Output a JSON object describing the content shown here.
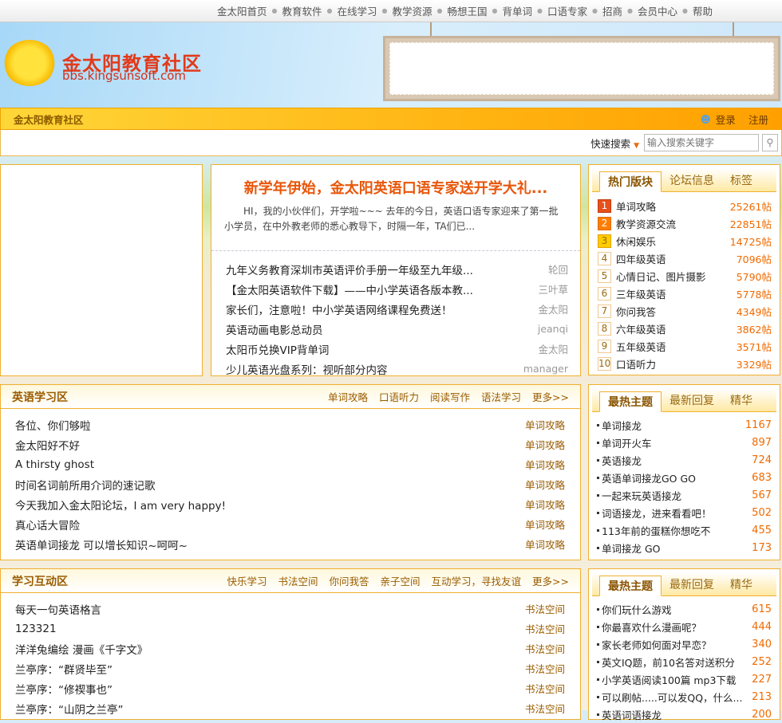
{
  "topnav": [
    "金太阳首页",
    "教育软件",
    "在线学习",
    "教学资源",
    "畅想王国",
    "背单词",
    "口语专家",
    "招商",
    "会员中心",
    "帮助"
  ],
  "logo": {
    "title": "金太阳教育社区",
    "url": "bbs.kingsunsoft.com"
  },
  "bar": {
    "title": "金太阳教育社区",
    "login": "登录",
    "register": "注册"
  },
  "search": {
    "label": "快速搜索",
    "placeholder": "输入搜索关键字"
  },
  "featured": {
    "title": "新学年伊始，金太阳英语口语专家送开学大礼...",
    "summary": "HI，我的小伙伴们，开学啦~~~ 去年的今日，英语口语专家迎来了第一批小学员，在中外教老师的悉心教导下，时隔一年，TA们已...",
    "items": [
      {
        "t": "九年义务教育深圳市英语评价手册一年级至九年级...",
        "a": "轮回"
      },
      {
        "t": "【金太阳英语软件下载】——中小学英语各版本教...",
        "a": "三叶草"
      },
      {
        "t": "家长们，注意啦！中小学英语网络课程免费送！",
        "a": "金太阳"
      },
      {
        "t": "英语动画电影总动员",
        "a": "jeanqi"
      },
      {
        "t": "太阳币兑换VIP背单词",
        "a": "金太阳"
      },
      {
        "t": "少儿英语光盘系列：视听部分内容",
        "a": "manager"
      }
    ]
  },
  "hotboards": {
    "tabs": [
      "热门版块",
      "论坛信息",
      "标签"
    ],
    "items": [
      {
        "n": "1",
        "t": "单词攻略",
        "c": "25261帖"
      },
      {
        "n": "2",
        "t": "教学资源交流",
        "c": "22851帖"
      },
      {
        "n": "3",
        "t": "休闲娱乐",
        "c": "14725帖"
      },
      {
        "n": "4",
        "t": "四年级英语",
        "c": "7096帖"
      },
      {
        "n": "5",
        "t": "心情日记、图片摄影",
        "c": "5790帖"
      },
      {
        "n": "6",
        "t": "三年级英语",
        "c": "5778帖"
      },
      {
        "n": "7",
        "t": "你问我答",
        "c": "4349帖"
      },
      {
        "n": "8",
        "t": "六年级英语",
        "c": "3862帖"
      },
      {
        "n": "9",
        "t": "五年级英语",
        "c": "3571帖"
      },
      {
        "n": "10",
        "t": "口语听力",
        "c": "3329帖"
      }
    ],
    "rank_colors": [
      "#e8501a",
      "#ff7e00",
      "#ffcc00"
    ]
  },
  "english": {
    "title": "英语学习区",
    "links": [
      "单词攻略",
      "口语听力",
      "阅读写作",
      "语法学习",
      "更多>>"
    ],
    "items": [
      {
        "t": "各位、你们够啦",
        "g": "单词攻略"
      },
      {
        "t": "金太阳好不好",
        "g": "单词攻略"
      },
      {
        "t": "A thirsty ghost",
        "g": "单词攻略"
      },
      {
        "t": "时间名词前所用介词的速记歌",
        "g": "单词攻略"
      },
      {
        "t": "今天我加入金太阳论坛，I am very happy!",
        "g": "单词攻略"
      },
      {
        "t": "真心话大冒险",
        "g": "单词攻略"
      },
      {
        "t": "英语单词接龙 可以增长知识~呵呵~",
        "g": "单词攻略"
      }
    ]
  },
  "interact": {
    "title": "学习互动区",
    "links": [
      "快乐学习",
      "书法空间",
      "你问我答",
      "亲子空间",
      "互动学习，寻找友谊",
      "更多>>"
    ],
    "items": [
      {
        "t": "每天一句英语格言",
        "g": "书法空间"
      },
      {
        "t": "123321",
        "g": "书法空间"
      },
      {
        "t": "洋洋兔编绘 漫画《千字文》",
        "g": "书法空间"
      },
      {
        "t": "兰亭序：“群贤毕至”",
        "g": "书法空间"
      },
      {
        "t": "兰亭序：“修禊事也”",
        "g": "书法空间"
      },
      {
        "t": "兰亭序：“山阴之兰亭”",
        "g": "书法空间"
      }
    ]
  },
  "hot1": {
    "tabs": [
      "最热主题",
      "最新回复",
      "精华"
    ],
    "items": [
      {
        "t": "单词接龙",
        "c": "1167"
      },
      {
        "t": "单词开火车",
        "c": "897"
      },
      {
        "t": "英语接龙",
        "c": "724"
      },
      {
        "t": "英语单词接龙GO GO",
        "c": "683"
      },
      {
        "t": "一起来玩英语接龙",
        "c": "567"
      },
      {
        "t": "词语接龙，进来看看吧！",
        "c": "502"
      },
      {
        "t": "113年前的蛋糕你想吃不",
        "c": "455"
      },
      {
        "t": "单词接龙 GO",
        "c": "173"
      }
    ]
  },
  "hot2": {
    "tabs": [
      "最热主题",
      "最新回复",
      "精华"
    ],
    "items": [
      {
        "t": "你们玩什么游戏",
        "c": "615"
      },
      {
        "t": "你最喜欢什么漫画呢？",
        "c": "444"
      },
      {
        "t": "家长老师如何面对早恋？",
        "c": "340"
      },
      {
        "t": "英文IQ题，前10名答对送积分",
        "c": "252"
      },
      {
        "t": "小学英语阅读100篇 mp3下载",
        "c": "227"
      },
      {
        "t": "可以刷帖.....可以发QQ，什么...",
        "c": "213"
      },
      {
        "t": "英语词语接龙",
        "c": "200"
      }
    ]
  }
}
